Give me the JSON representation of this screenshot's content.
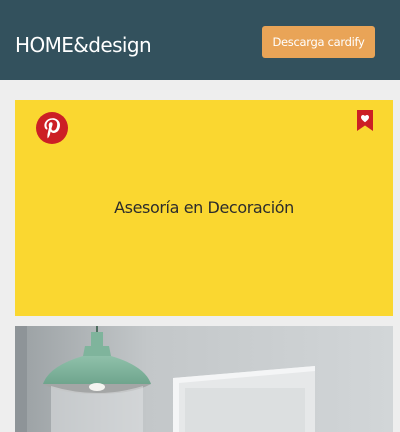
{
  "header": {
    "brand": "HOME&design",
    "download_button": "Descarga cardify",
    "background": "#33515d",
    "button_color": "#e9a457"
  },
  "card": {
    "title": "Asesoría en Decoración",
    "background": "#fad730",
    "share_icon": "pinterest-icon",
    "save_icon": "heart-bookmark-icon"
  },
  "photo": {
    "subject": "pendant-lamp-interior"
  }
}
